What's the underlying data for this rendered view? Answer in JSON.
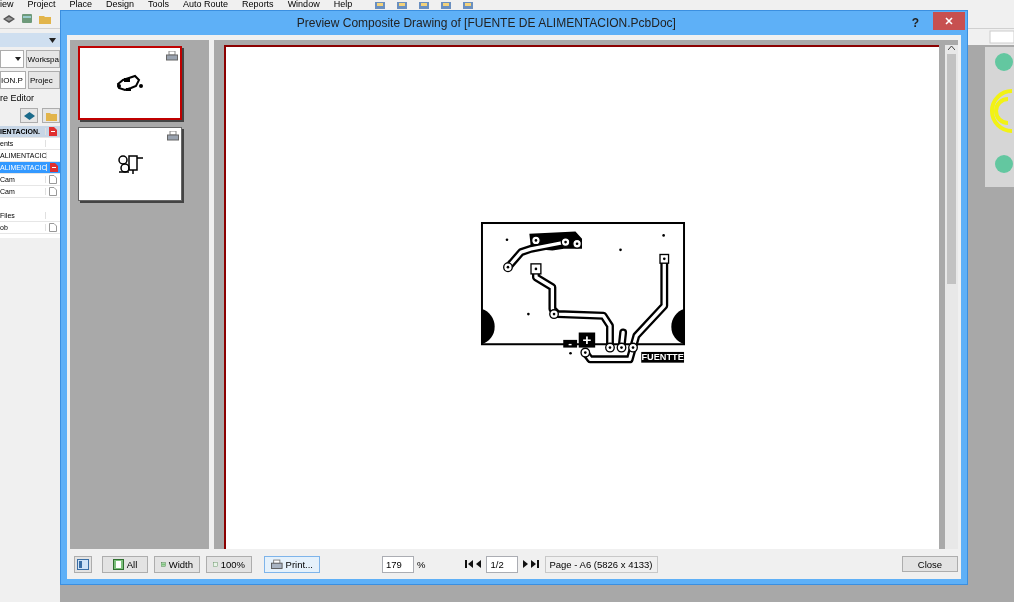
{
  "app": {
    "menu": [
      "iew",
      "Project",
      "Place",
      "Design",
      "Tools",
      "Auto Route",
      "Reports",
      "Window",
      "Help"
    ],
    "panel": {
      "tab": "Workspa",
      "project_field": "ION.P",
      "project_button": "Projec",
      "editor_label": "re Editor",
      "tree_header": {
        "label": "IENTACION.",
        "kind": "pcb"
      },
      "items": [
        {
          "label": "ents",
          "kind": "none",
          "selected": false
        },
        {
          "label": "ALIMENTACIC",
          "kind": "none",
          "selected": false
        },
        {
          "label": "ALIMENTACIC",
          "kind": "pcb",
          "selected": true
        },
        {
          "label": "Cam",
          "kind": "doc",
          "selected": false
        },
        {
          "label": "Cam",
          "kind": "doc",
          "selected": false
        },
        {
          "label": "Files",
          "kind": "section",
          "selected": false
        },
        {
          "label": "ob",
          "kind": "doc",
          "selected": false
        }
      ]
    }
  },
  "dialog": {
    "title": "Preview Composite Drawing of [FUENTE DE ALIMENTACION.PcbDoc]",
    "help": "?",
    "thumbnails": [
      {
        "kind": "board",
        "selected": true
      },
      {
        "kind": "parts",
        "selected": false
      }
    ],
    "board": {
      "plus": "+",
      "minus": "-",
      "label": "FUENTTE"
    },
    "toolbar": {
      "buttons": [
        {
          "label": "All",
          "kind": "all"
        },
        {
          "label": "Width",
          "kind": "width"
        },
        {
          "label": "100%",
          "kind": "full"
        }
      ],
      "print": "Print...",
      "zoom": "179",
      "percent": "%",
      "page": "1/2",
      "page_info": "Page - A6 (5826 x 4133)",
      "close": "Close"
    }
  }
}
